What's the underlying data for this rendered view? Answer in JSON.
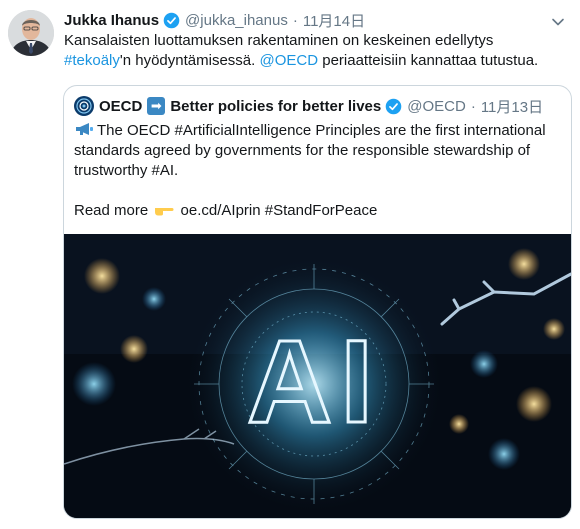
{
  "tweet": {
    "author_name": "Jukka Ihanus",
    "handle": "@jukka_ihanus",
    "separator": "·",
    "date": "11月14日",
    "text_part1": "Kansalaisten luottamuksen rakentaminen on keskeinen edellytys ",
    "hashtag": "#tekoäly",
    "text_part2": "'n hyödyntämisessä. ",
    "mention": "@OECD",
    "text_part3": " periaatteisiin kannattaa tutustua."
  },
  "quoted": {
    "author_name": "OECD",
    "author_suffix": "Better policies for better lives",
    "arrow_glyph": "➡",
    "handle": "@OECD",
    "separator": "·",
    "date": "11月13日",
    "body": "The OECD #ArtificialIntelligence Principles are the first international standards agreed by governments for the responsible stewardship of trustworthy #AI.",
    "read_more": "Read more",
    "link": "oe.cd/AIprin #StandForPeace",
    "image_text": "AI"
  },
  "colors": {
    "link": "#1b95e0",
    "verified": "#1da1f2",
    "muted": "#657786",
    "border": "#ccd6dd"
  },
  "icons": [
    "chevron-down-icon",
    "verified-badge-icon",
    "megaphone-icon",
    "pointing-hand-icon",
    "oecd-logo-icon",
    "arrow-right-icon"
  ]
}
